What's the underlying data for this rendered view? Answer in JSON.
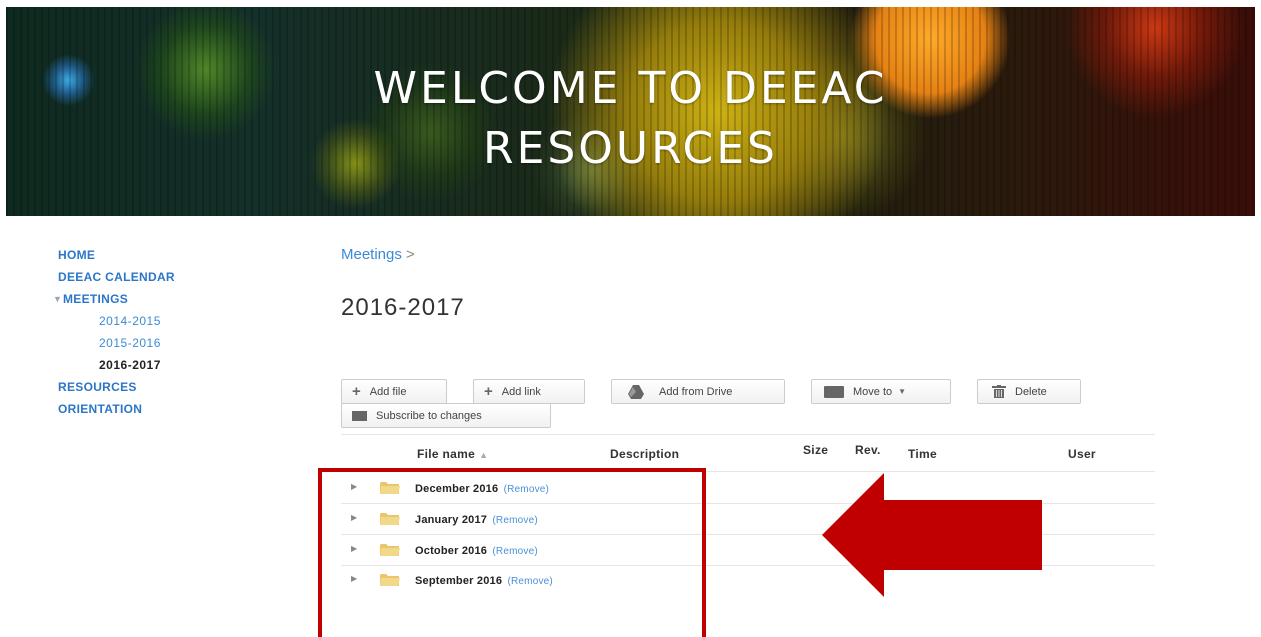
{
  "banner": {
    "title_line1": "WELCOME TO DEEAC",
    "title_line2": "RESOURCES"
  },
  "sidebar": {
    "items": [
      {
        "label": "HOME"
      },
      {
        "label": "DEEAC CALENDAR"
      },
      {
        "label": "MEETINGS",
        "expanded": true
      },
      {
        "label": "RESOURCES"
      },
      {
        "label": "ORIENTATION"
      }
    ],
    "meetings_children": [
      {
        "label": "2014-2015"
      },
      {
        "label": "2015-2016"
      },
      {
        "label": "2016-2017",
        "active": true
      }
    ]
  },
  "breadcrumb": {
    "parent": "Meetings",
    "separator": ">"
  },
  "page_title": "2016-2017",
  "toolbar": {
    "add_file": "Add file",
    "add_link": "Add link",
    "add_from_drive": "Add from Drive",
    "move_to": "Move to",
    "delete": "Delete",
    "subscribe": "Subscribe to changes"
  },
  "table": {
    "headers": {
      "file_name": "File name",
      "description": "Description",
      "size": "Size",
      "rev": "Rev.",
      "time": "Time",
      "user": "User"
    },
    "rows": [
      {
        "name": "December 2016",
        "remove": "(Remove)"
      },
      {
        "name": "January 2017",
        "remove": "(Remove)"
      },
      {
        "name": "October 2016",
        "remove": "(Remove)"
      },
      {
        "name": "September 2016",
        "remove": "(Remove)"
      }
    ]
  },
  "colors": {
    "link": "#2c76c8",
    "annotation_red": "#c00000"
  },
  "icons": [
    "plus-icon",
    "drive-icon",
    "folder-icon",
    "caret-down-icon",
    "trash-icon",
    "mail-icon",
    "sort-up-icon",
    "expand-triangle-icon",
    "annotation-arrow"
  ]
}
